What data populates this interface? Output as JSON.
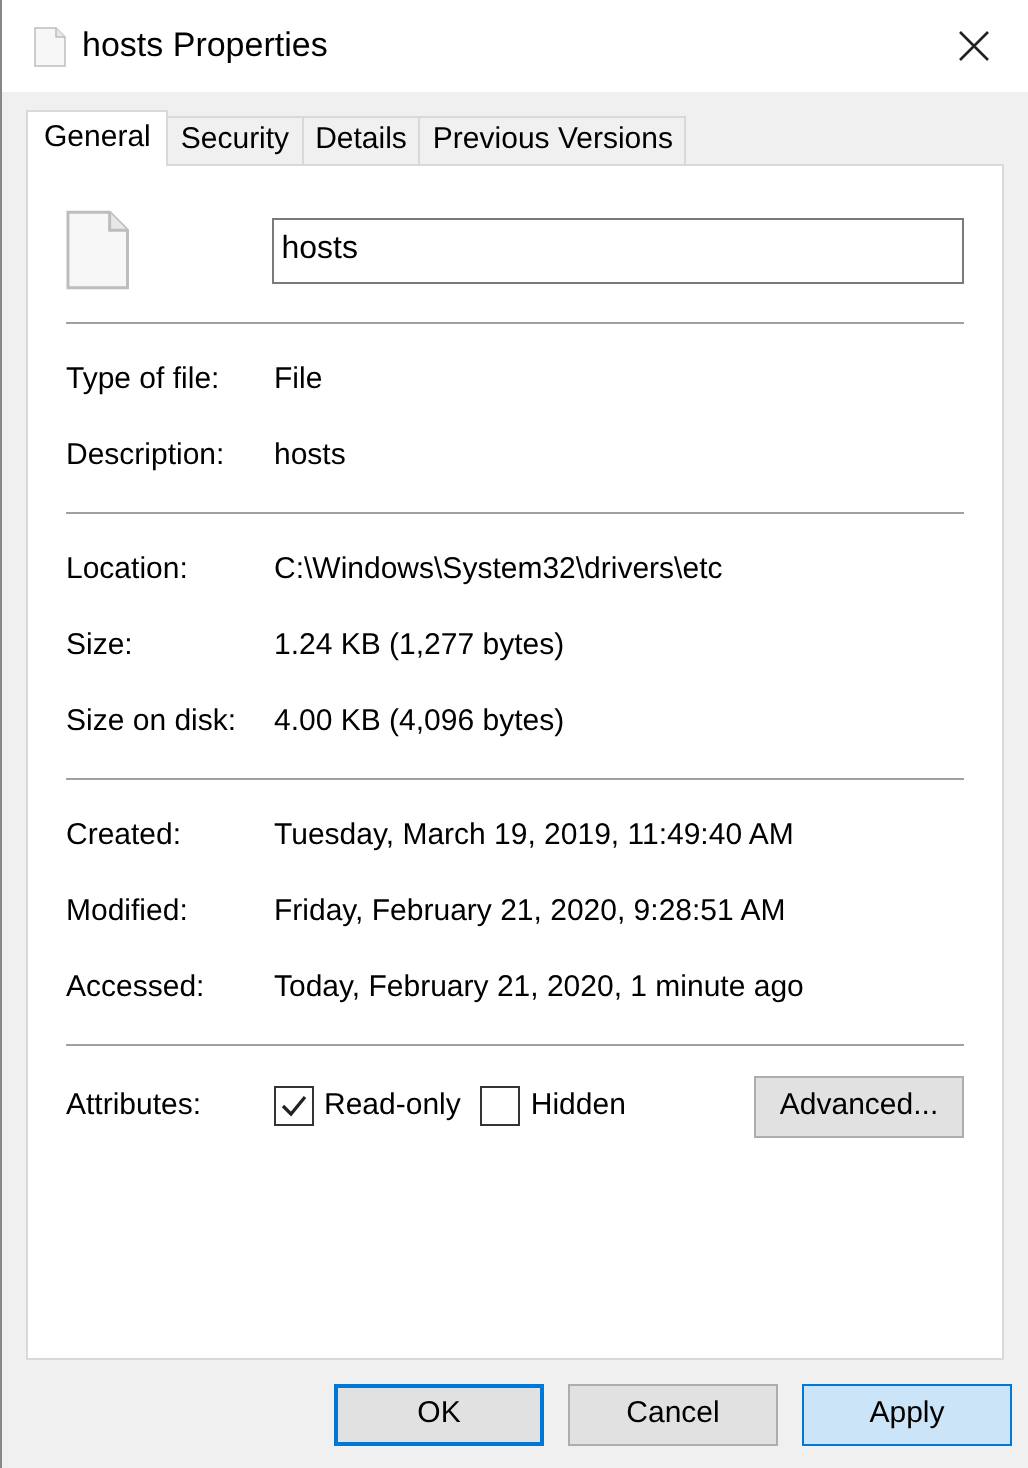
{
  "window": {
    "title": "hosts Properties"
  },
  "tabs": [
    {
      "label": "General",
      "selected": true
    },
    {
      "label": "Security",
      "selected": false
    },
    {
      "label": "Details",
      "selected": false
    },
    {
      "label": "Previous Versions",
      "selected": false
    }
  ],
  "file_name": {
    "value": "hosts"
  },
  "sections": [
    [
      {
        "label": "Type of file:",
        "value": "File"
      },
      {
        "label": "Description:",
        "value": "hosts"
      }
    ],
    [
      {
        "label": "Location:",
        "value": "C:\\Windows\\System32\\drivers\\etc"
      },
      {
        "label": "Size:",
        "value": "1.24 KB (1,277 bytes)"
      },
      {
        "label": "Size on disk:",
        "value": "4.00 KB (4,096 bytes)"
      }
    ],
    [
      {
        "label": "Created:",
        "value": "Tuesday, March 19, 2019, 11:49:40 AM"
      },
      {
        "label": "Modified:",
        "value": "Friday, February 21, 2020, 9:28:51 AM"
      },
      {
        "label": "Accessed:",
        "value": "Today, February 21, 2020, 1 minute ago"
      }
    ]
  ],
  "attributes": {
    "label": "Attributes:",
    "items": [
      {
        "label": "Read-only",
        "checked": true
      },
      {
        "label": "Hidden",
        "checked": false
      }
    ],
    "advanced": "Advanced..."
  },
  "buttons": [
    {
      "label": "OK",
      "kind": "default"
    },
    {
      "label": "Cancel",
      "kind": "normal"
    },
    {
      "label": "Apply",
      "kind": "hover"
    }
  ]
}
